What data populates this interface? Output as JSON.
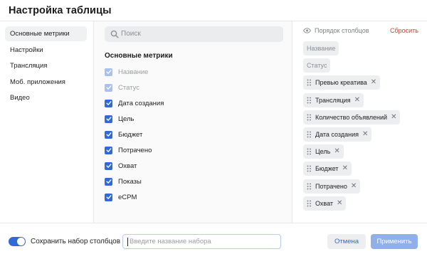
{
  "dialog": {
    "title": "Настройка таблицы"
  },
  "sidebar": {
    "items": [
      {
        "label": "Основные метрики",
        "active": true
      },
      {
        "label": "Настройки",
        "active": false
      },
      {
        "label": "Трансляция",
        "active": false
      },
      {
        "label": "Моб. приложения",
        "active": false
      },
      {
        "label": "Видео",
        "active": false
      }
    ]
  },
  "search": {
    "placeholder": "Поиск",
    "icon": "search-icon"
  },
  "metrics": {
    "heading": "Основные метрики",
    "items": [
      {
        "label": "Название",
        "checked": true,
        "disabled": true
      },
      {
        "label": "Статус",
        "checked": true,
        "disabled": true
      },
      {
        "label": "Дата создания",
        "checked": true,
        "disabled": false
      },
      {
        "label": "Цель",
        "checked": true,
        "disabled": false
      },
      {
        "label": "Бюджет",
        "checked": true,
        "disabled": false
      },
      {
        "label": "Потрачено",
        "checked": true,
        "disabled": false
      },
      {
        "label": "Охват",
        "checked": true,
        "disabled": false
      },
      {
        "label": "Показы",
        "checked": true,
        "disabled": false
      },
      {
        "label": "eCPM",
        "checked": true,
        "disabled": false
      }
    ]
  },
  "order": {
    "title": "Порядок столбцов",
    "icon": "eye-icon",
    "reset_label": "Сбросить",
    "chips": [
      {
        "label": "Название",
        "removable": false
      },
      {
        "label": "Статус",
        "removable": false
      },
      {
        "label": "Превью креатива",
        "removable": true
      },
      {
        "label": "Трансляция",
        "removable": true
      },
      {
        "label": "Количество объявлений",
        "removable": true
      },
      {
        "label": "Дата создания",
        "removable": true
      },
      {
        "label": "Цель",
        "removable": true
      },
      {
        "label": "Бюджет",
        "removable": true
      },
      {
        "label": "Потрачено",
        "removable": true
      },
      {
        "label": "Охват",
        "removable": true
      }
    ]
  },
  "footer": {
    "toggle_on": true,
    "save_label": "Сохранить набор столбцов",
    "name_placeholder": "Введите название набора",
    "cancel_label": "Отмена",
    "apply_label": "Применить"
  },
  "colors": {
    "accent": "#2f6bd6",
    "danger": "#d2403a",
    "apply_disabled": "#8fb0e8"
  }
}
